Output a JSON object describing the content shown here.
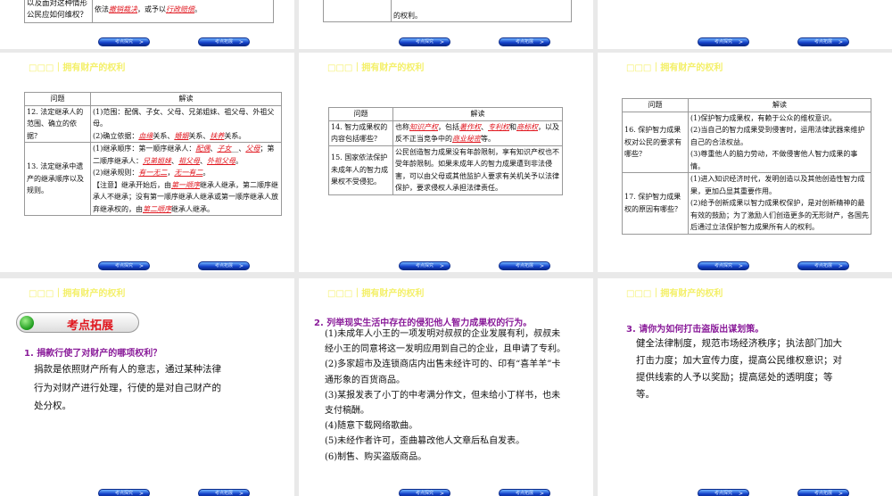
{
  "nav": {
    "prev_label": "考点探究",
    "next_label": "考点拓展"
  },
  "header_title": "□□□｜拥有财产的权利",
  "slide_top_left": {
    "question": "以及面对这种情形公民应如何维权？",
    "answer": [
      {
        "t": "依法"
      },
      {
        "t": "撤销裁决",
        "hl": true
      },
      {
        "t": "，或予以"
      },
      {
        "t": "行政赔偿",
        "hl": true
      },
      {
        "t": "。"
      }
    ]
  },
  "slide_top_mid": {
    "answer": "的权利。"
  },
  "table_headers": {
    "question": "问题",
    "answer": "解读"
  },
  "table1": [
    {
      "q": "12. 法定继承人的范围、确立的依据？",
      "a": [
        [
          {
            "t": "(1)范围：配偶、子女、父母、兄弟姐妹、祖父母、外祖父母。"
          }
        ],
        [
          {
            "t": "(2)确立依据："
          },
          {
            "t": "血缘",
            "hl": true
          },
          {
            "t": "关系、"
          },
          {
            "t": "婚姻",
            "hl": true
          },
          {
            "t": "关系、"
          },
          {
            "t": "扶养",
            "hl": true
          },
          {
            "t": "关系。"
          }
        ]
      ]
    },
    {
      "q": "13. 法定继承中遗产的继承顺序以及规则。",
      "a": [
        [
          {
            "t": "(1)继承顺序：第一顺序继承人："
          },
          {
            "t": "配偶",
            "hl": true
          },
          {
            "t": "、"
          },
          {
            "t": "子女",
            "hl": true
          },
          {
            "t": "__、"
          },
          {
            "t": "父母",
            "hl": true
          },
          {
            "t": "；第二顺序继承人："
          },
          {
            "t": "兄弟姐妹",
            "hl": true
          },
          {
            "t": "、"
          },
          {
            "t": "祖父母",
            "hl": true
          },
          {
            "t": "、"
          },
          {
            "t": "外祖父母",
            "hl": true
          },
          {
            "t": "。"
          }
        ],
        [
          {
            "t": "(2)继承规则："
          },
          {
            "t": "有一无二",
            "hl": true
          },
          {
            "t": "，"
          },
          {
            "t": "无一有二",
            "hl": true
          },
          {
            "t": "。"
          }
        ],
        [
          {
            "t": "【注意】继承开始后，由"
          },
          {
            "t": "第一顺序",
            "hl": true
          },
          {
            "t": "继承人继承，第二顺序继承人不继承；没有第一顺序继承人继承或第一顺序继承人放弃继承权的，由"
          },
          {
            "t": "第二顺序",
            "hl": true
          },
          {
            "t": "继承人继承。"
          }
        ]
      ]
    }
  ],
  "table2": [
    {
      "q": "14. 智力成果权的内容包括哪些？",
      "a": [
        [
          {
            "t": "也称"
          },
          {
            "t": "知识产权",
            "hl": true
          },
          {
            "t": "，包括"
          },
          {
            "t": "著作权",
            "hl": true
          },
          {
            "t": "、"
          },
          {
            "t": "专利权",
            "hl": true
          },
          {
            "t": "和"
          },
          {
            "t": "商标权",
            "hl": true
          },
          {
            "t": "，以及反不正当竞争中的"
          },
          {
            "t": "商业秘密",
            "hl": true
          },
          {
            "t": "等。"
          }
        ]
      ]
    },
    {
      "q": "15. 国家依法保护未成年人的智力成果权不受侵犯。",
      "a": [
        [
          {
            "t": "公民创造智力成果没有年龄限制，享有知识产权也不受年龄限制。如果未成年人的智力成果遭到非法侵害，可以由父母或其他监护人要求有关机关予以法律保护，要求侵权人承担法律责任。"
          }
        ]
      ]
    }
  ],
  "table3": [
    {
      "q": "16. 保护智力成果权对公民的要求有哪些？",
      "a": [
        [
          {
            "t": "(1)保护智力成果权，有赖于公众的维权意识。"
          }
        ],
        [
          {
            "t": "(2)当自己的智力成果受到侵害时，运用法律武器来维护自己的合法权益。"
          }
        ],
        [
          {
            "t": "(3)尊重他人的脑力劳动，不做侵害他人智力成果的事情。"
          }
        ]
      ]
    },
    {
      "q": "17. 保护智力成果权的原因有哪些？",
      "a": [
        [
          {
            "t": "(1)进入知识经济时代，发明创造以及其他创造性智力成果，更加凸显其重要作用。"
          }
        ],
        [
          {
            "t": "(2)给予创新成果以智力成果权保护，是对创新精神的最有效的鼓励；为了激励人们创造更多的无形财产，各国先后通过立法保护智力成果所有人的权利。"
          }
        ]
      ]
    }
  ],
  "extension": {
    "badge": "考点拓展",
    "q1": "1. 捐款行使了对财产的哪项权利？",
    "a1": "捐款是依照财产所有人的意志，通过某种法律行为对财产进行处理，行使的是对自己财产的处分权。",
    "q2": "2. 列举现实生活中存在的侵犯他人智力成果权的行为。",
    "a2": [
      "(1)未成年人小王的一项发明对叔叔的企业发展有利，叔叔未经小王的同意将这一发明应用到自己的企业，且申请了专利。",
      "(2)多家超市及连锁商店内出售未经许可的、印有“喜羊羊”卡通形象的百货商品。",
      "(3)某报发表了小丁的中考满分作文，但未给小丁样书，也未支付稿酬。",
      "(4)随意下载网络歌曲。",
      "(5)未经作者许可，歪曲篡改他人文章后私自发表。",
      "(6)制售、购买盗版商品。"
    ],
    "q3": "3. 请你为如何打击盗版出谋划策。",
    "a3": "健全法律制度，规范市场经济秩序；执法部门加大打击力度；加大宣传力度，提高公民维权意识；对提供线索的人予以奖励；提高惩处的透明度；等等。"
  }
}
